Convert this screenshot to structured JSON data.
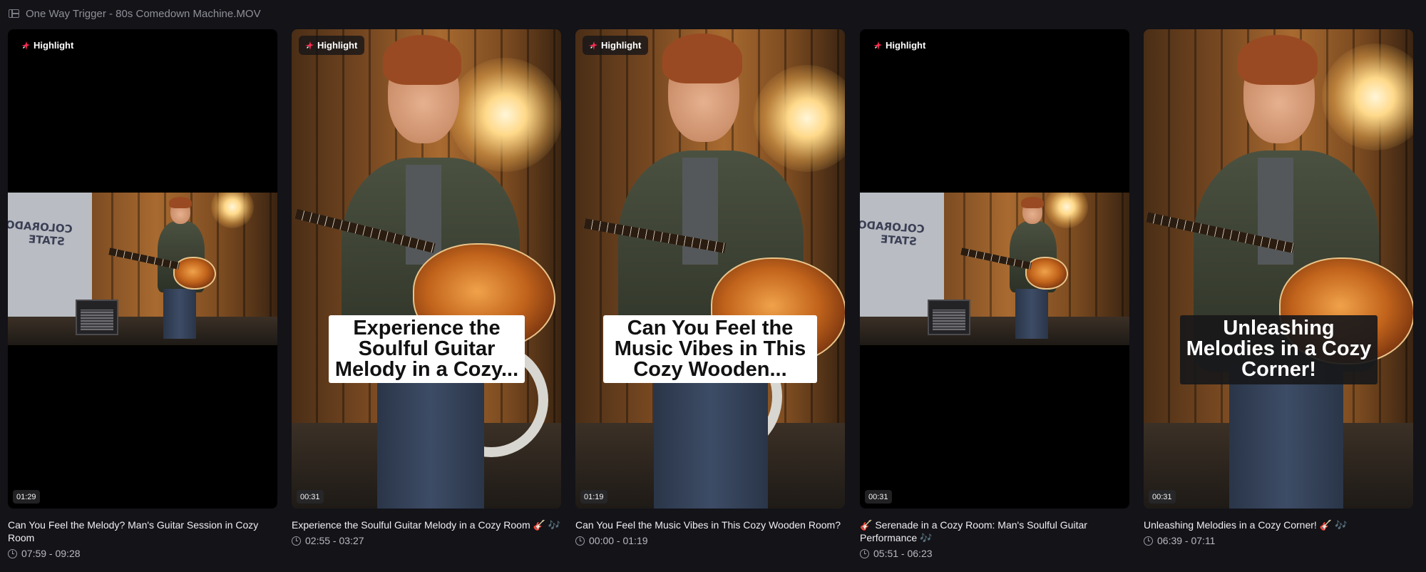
{
  "file": {
    "title": "One Way Trigger - 80s Comedown Machine.MOV",
    "icon": "film-strip-icon"
  },
  "colors": {
    "background": "#131318",
    "highlight_icon": "#ff2d55",
    "caption_light_bg": "#ffffff",
    "caption_dark_bg": "#18181a"
  },
  "clips": [
    {
      "badge": "Highlight",
      "duration": "01:29",
      "title": "Can You Feel the Melody? Man's Guitar Session in Cozy Room",
      "time_range": "07:59 - 09:28",
      "caption": "",
      "caption_style": "none",
      "framing": "letterbox"
    },
    {
      "badge": "Highlight",
      "duration": "00:31",
      "title": "Experience the Soulful Guitar Melody in a Cozy Room 🎸 🎶",
      "time_range": "02:55 - 03:27",
      "caption": "Experience the Soulful Guitar Melody in a Cozy...",
      "caption_style": "light",
      "framing": "full"
    },
    {
      "badge": "Highlight",
      "duration": "01:19",
      "title": "Can You Feel the Music Vibes in This Cozy Wooden Room?",
      "time_range": "00:00 - 01:19",
      "caption": "Can You Feel the Music Vibes in This Cozy Wooden...",
      "caption_style": "light",
      "framing": "full"
    },
    {
      "badge": "Highlight",
      "duration": "00:31",
      "title": "🎸 Serenade in a Cozy Room: Man's Soulful Guitar Performance 🎶",
      "time_range": "05:51 - 06:23",
      "caption": "",
      "caption_style": "none",
      "framing": "letterbox"
    },
    {
      "badge": "Highlight",
      "duration": "00:31",
      "title": "Unleashing Melodies in a Cozy Corner! 🎸 🎶",
      "time_range": "06:39 - 07:11",
      "caption": "Unleashing Melodies in a Cozy Corner!",
      "caption_style": "dark",
      "framing": "full"
    }
  ],
  "banner_text": "COLORADO STATE"
}
